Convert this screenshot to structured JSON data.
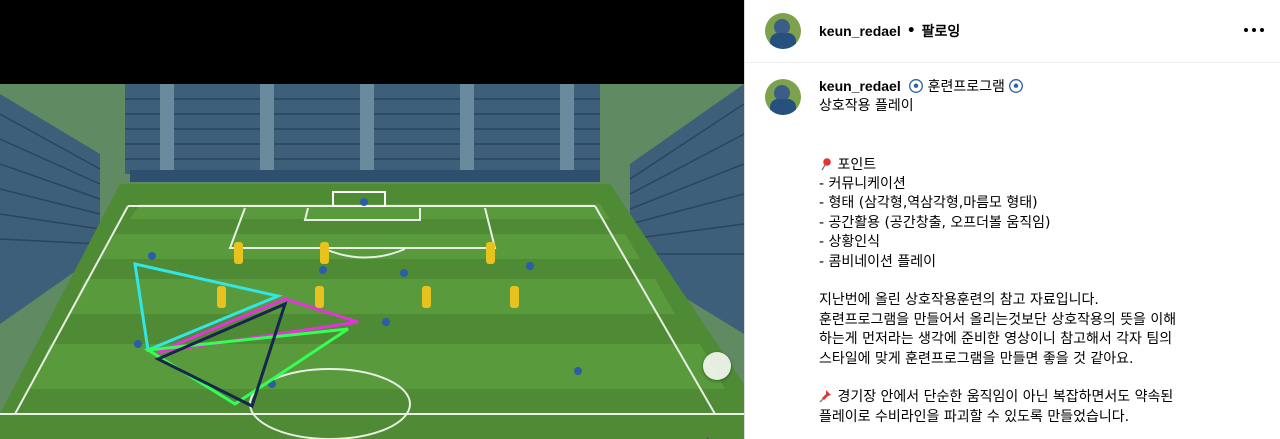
{
  "post": {
    "username": "keun_redael",
    "separator": "•",
    "follow_label": "팔로잉",
    "more_icon": "more-horizontal-icon",
    "next_icon": "chevron-right-icon"
  },
  "caption": {
    "username": "keun_redael",
    "title": "훈련프로그램",
    "line_subtitle": "상호작용 플레이",
    "points_heading": "포인트",
    "points": [
      "- 커뮤니케이션",
      "- 형태 (삼각형,역삼각형,마름모 형태)",
      "- 공간활용 (공간창출, 오프더볼 움직임)",
      "- 상황인식",
      "- 콤비네이션 플레이"
    ],
    "paragraph": [
      "지난번에 올린 상호작용훈련의 참고 자료입니다.",
      "훈련프로그램을 만들어서 올리는것보단 상호작용의 뜻을 이해",
      "하는게 먼저라는 생각에 준비한 영상이니 참고해서 각자 팀의",
      "스타일에 맞게 훈련프로그램을 만들면 좋을 것 같아요."
    ],
    "closing": [
      "경기장 안에서 단순한 움직임이 아닌 복잡하면서도 약속된",
      "플레이로 수비라인을 파괴할 수 있도록 만들었습니다."
    ]
  },
  "colors": {
    "triangle_cyan": "#33e6e6",
    "triangle_magenta": "#e633d9",
    "triangle_green": "#33ff55",
    "triangle_navy": "#16264d",
    "pitch": "#4f8a35"
  }
}
